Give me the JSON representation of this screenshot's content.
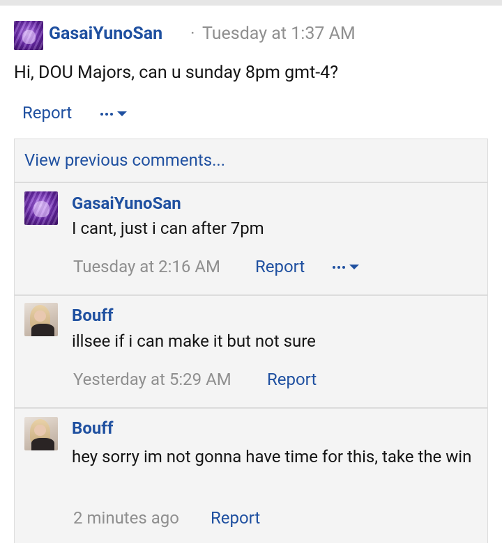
{
  "post": {
    "author": "GasaiYunoSan",
    "separator": "·",
    "timestamp": "Tuesday at 1:37 AM",
    "message": "Hi, DOU Majors, can u sunday 8pm gmt-4?",
    "report_label": "Report"
  },
  "comments_box": {
    "view_previous_label": "View previous comments...",
    "comments": [
      {
        "author": "GasaiYunoSan",
        "message": "I cant, just i can after 7pm",
        "timestamp": "Tuesday at 2:16 AM",
        "report_label": "Report",
        "has_more_menu": true
      },
      {
        "author": "Bouff",
        "message": "illsee if i can make it but not sure",
        "timestamp": "Yesterday at 5:29 AM",
        "report_label": "Report",
        "has_more_menu": false
      },
      {
        "author": "Bouff",
        "message": "hey sorry im not gonna have time for this, take the win",
        "timestamp": "2 minutes ago",
        "report_label": "Report",
        "has_more_menu": false
      }
    ]
  },
  "colors": {
    "link": "#1f50a0",
    "muted": "#8f8f8f",
    "comment_bg": "#f4f4f4",
    "border": "#dcdcdc"
  },
  "icons": {
    "more_menu": "ellipsis-icon",
    "dropdown": "caret-down-icon"
  }
}
